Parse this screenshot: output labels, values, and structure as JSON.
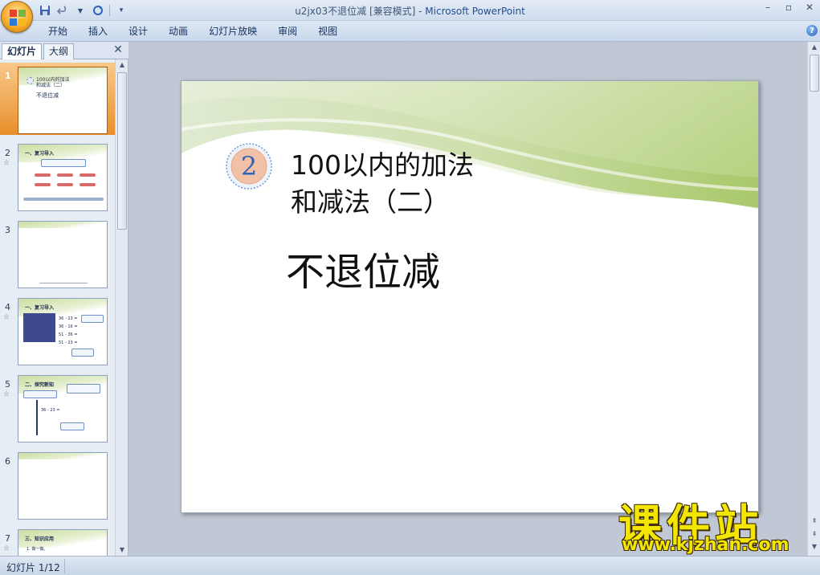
{
  "window": {
    "title_file": "u2jx03不退位减 [兼容模式]",
    "title_sep": " - ",
    "title_app": "Microsoft PowerPoint"
  },
  "ribbon": {
    "tabs": [
      "开始",
      "插入",
      "设计",
      "动画",
      "幻灯片放映",
      "审阅",
      "视图"
    ]
  },
  "left_pane": {
    "tab_slides": "幻灯片",
    "tab_outline": "大纲",
    "thumbnails": [
      {
        "num": "1",
        "selected": true,
        "title": "100以内的加法",
        "line2": "和减法（二）",
        "sub": "不退位减"
      },
      {
        "num": "2",
        "caption": "一、复习导入"
      },
      {
        "num": "3"
      },
      {
        "num": "4",
        "caption": "一、复习导入",
        "lines": [
          "36 - 23 =",
          "36 - 16 =",
          "51 - 36 =",
          "51 - 23 ="
        ]
      },
      {
        "num": "5",
        "caption": "二、探究新知",
        "expr": "36 - 23 ="
      },
      {
        "num": "6"
      },
      {
        "num": "7",
        "caption": "三、知识应用",
        "line": "1. 做一做。"
      }
    ]
  },
  "slide": {
    "badge_number": "2",
    "title_line1": "100以内的加法",
    "title_line2": "和减法（二）",
    "subtitle": "不退位减",
    "colors": {
      "band_green": "#a9c86a",
      "badge_blue": "#2d66b8",
      "badge_fill": "#f0c1a6"
    }
  },
  "watermark": {
    "cn": "课件站",
    "url": "www.kjzhan.com"
  },
  "status": {
    "slide_indicator": "幻灯片 1/12"
  }
}
